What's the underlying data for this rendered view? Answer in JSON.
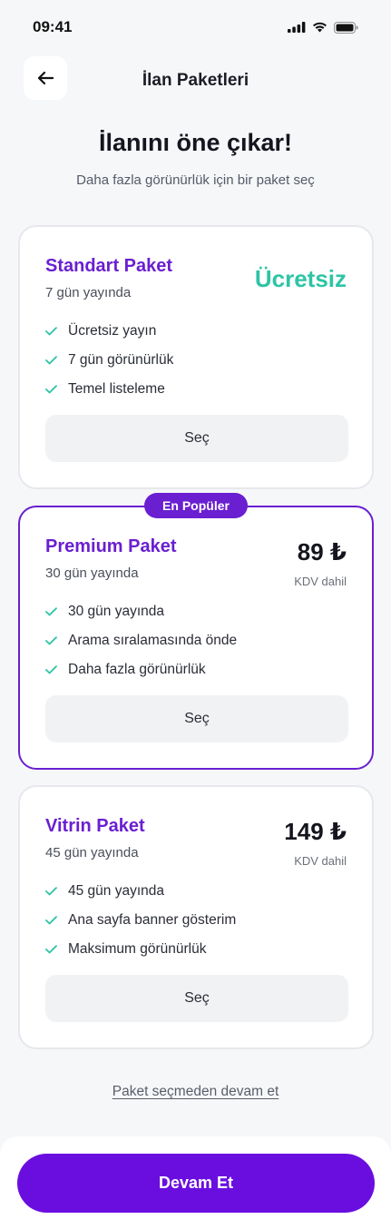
{
  "status_bar": {
    "time": "09:41"
  },
  "header": {
    "title": "İlan Paketleri"
  },
  "hero": {
    "title": "İlanını öne çıkar!",
    "subtitle": "Daha fazla görünürlük için bir paket seç"
  },
  "packages": [
    {
      "name": "Standart Paket",
      "duration": "7 gün yayında",
      "price": "Ücretsiz",
      "features": [
        "Ücretsiz yayın",
        "7 gün görünürlük",
        "Temel listeleme"
      ],
      "button": "Seç"
    },
    {
      "name": "Premium Paket",
      "duration": "30 gün yayında",
      "price": "89 ₺",
      "vat": "KDV dahil",
      "badge": "En Popüler",
      "features": [
        "30 gün yayında",
        "Arama sıralamasında önde",
        "Daha fazla görünürlük"
      ],
      "button": "Seç"
    },
    {
      "name": "Vitrin Paket",
      "duration": "45 gün yayında",
      "price": "149 ₺",
      "vat": "KDV dahil",
      "features": [
        "45 gün yayında",
        "Ana sayfa banner gösterim",
        "Maksimum görünürlük"
      ],
      "button": "Seç"
    }
  ],
  "skip_link": "Paket seçmeden devam et",
  "footer": {
    "continue_label": "Devam Et"
  },
  "colors": {
    "accent": "#6a1fd1",
    "cta": "#6a0ee0",
    "free": "#2ec4a6",
    "check": "#2ec4a6"
  }
}
